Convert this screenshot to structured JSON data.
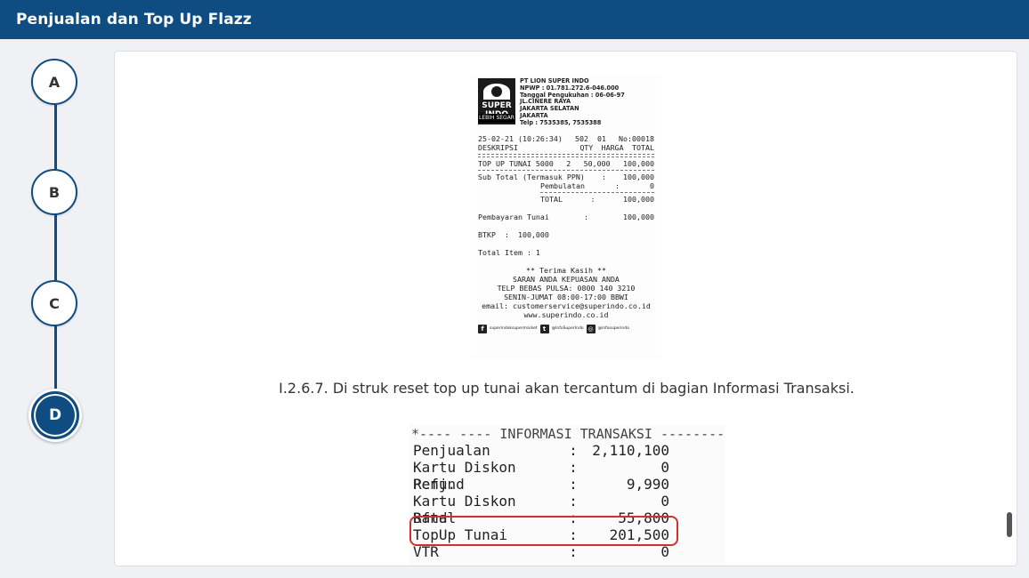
{
  "header": {
    "title": "Penjualan dan Top Up Flazz"
  },
  "steps": {
    "a": "A",
    "b": "B",
    "c": "C",
    "d": "D"
  },
  "receipt_top": {
    "company": "PT LION SUPER INDO",
    "npwp": "NPWP : 01.781.272.6-046.000",
    "tanggal": "Tanggal Pengukuhan : 06-06-97",
    "address1": "JL.CINERE RAYA",
    "address2": "JAKARTA SELATAN",
    "address3": "JAKARTA",
    "telp": "Telp : 7535385, 7535388",
    "logo_brand": "SUPER INDO",
    "logo_tag": "LEBIH SEGAR",
    "datetime": "25-02-21 (10:26:34)",
    "store": "502  01",
    "no": "No:00018",
    "col_desc": "DESKRIPSI",
    "col_qty": "QTY",
    "col_harga": "HARGA",
    "col_total": "TOTAL",
    "item_name": "TOP UP TUNAI 5000",
    "item_qty": "2",
    "item_harga": "50,000",
    "item_total": "100,000",
    "subtotal_label": "Sub Total (Termasuk PPN)",
    "subtotal_val": "100,000",
    "pembulatan_label": "Pembulatan",
    "pembulatan_val": "0",
    "total_label": "TOTAL",
    "total_val": "100,000",
    "bayar_label": "Pembayaran Tunai",
    "bayar_val": "100,000",
    "btkp": "BTKP  :  100,000",
    "total_item": "Total Item : 1",
    "thanks": "** Terima Kasih **",
    "saran": "SARAN ANDA KEPUASAN ANDA",
    "pulsa": "TELP BEBAS PULSA: 0800 140 3210",
    "hours": "SENIN-JUMAT 08:00-17:00 BBWI",
    "email": "email: customerservice@superindo.co.id",
    "web": "www.superindo.co.id",
    "social_fb": "superindoksupermarket",
    "social_tw": "@InfoSuperIndo",
    "social_ig": "@infosuperindo"
  },
  "caption": "I.2.6.7. Di struk reset top up tunai akan tercantum di bagian Informasi Transaksi.",
  "receipt_bottom": {
    "title": "*---- ---- INFORMASI TRANSAKSI --------*",
    "rows": [
      {
        "label": "Penjualan",
        "value": "2,110,100"
      },
      {
        "label": "Kartu Diskon Penj.",
        "value": "0"
      },
      {
        "label": "Refund",
        "value": "9,990"
      },
      {
        "label": "Kartu Diskon Rfnd",
        "value": "0"
      },
      {
        "label": "Batal",
        "value": "55,800"
      },
      {
        "label": "TopUp Tunai",
        "value": "201,500"
      },
      {
        "label": "VTR",
        "value": "0"
      }
    ],
    "colon": ":"
  },
  "colors": {
    "header": "#0f4c81",
    "highlight": "#d32f2f"
  }
}
